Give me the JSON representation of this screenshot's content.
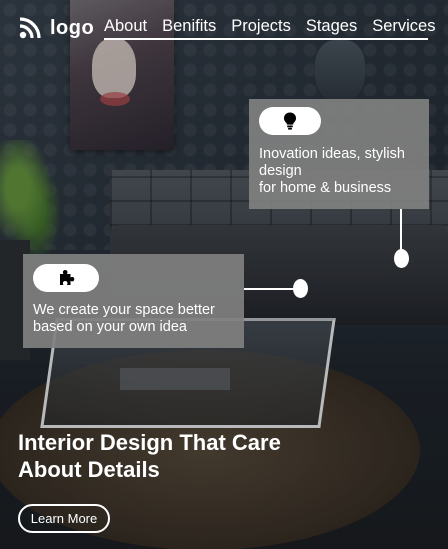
{
  "brand": {
    "logo_text": "logo",
    "logo_icon": "wifi-signal-icon"
  },
  "nav": {
    "items": [
      {
        "label": "About"
      },
      {
        "label": "Benifits"
      },
      {
        "label": "Projects"
      },
      {
        "label": "Stages"
      },
      {
        "label": "Services"
      }
    ]
  },
  "features": [
    {
      "icon": "lightbulb-icon",
      "text": "Inovation ideas, stylish design\nfor home & business"
    },
    {
      "icon": "puzzle-piece-icon",
      "text": "We create your space better based on your own idea"
    }
  ],
  "hero": {
    "headline": "Interior Design That Care About Details",
    "cta_label": "Learn More"
  },
  "colors": {
    "card_bg": "#808080",
    "accent": "#ffffff"
  }
}
